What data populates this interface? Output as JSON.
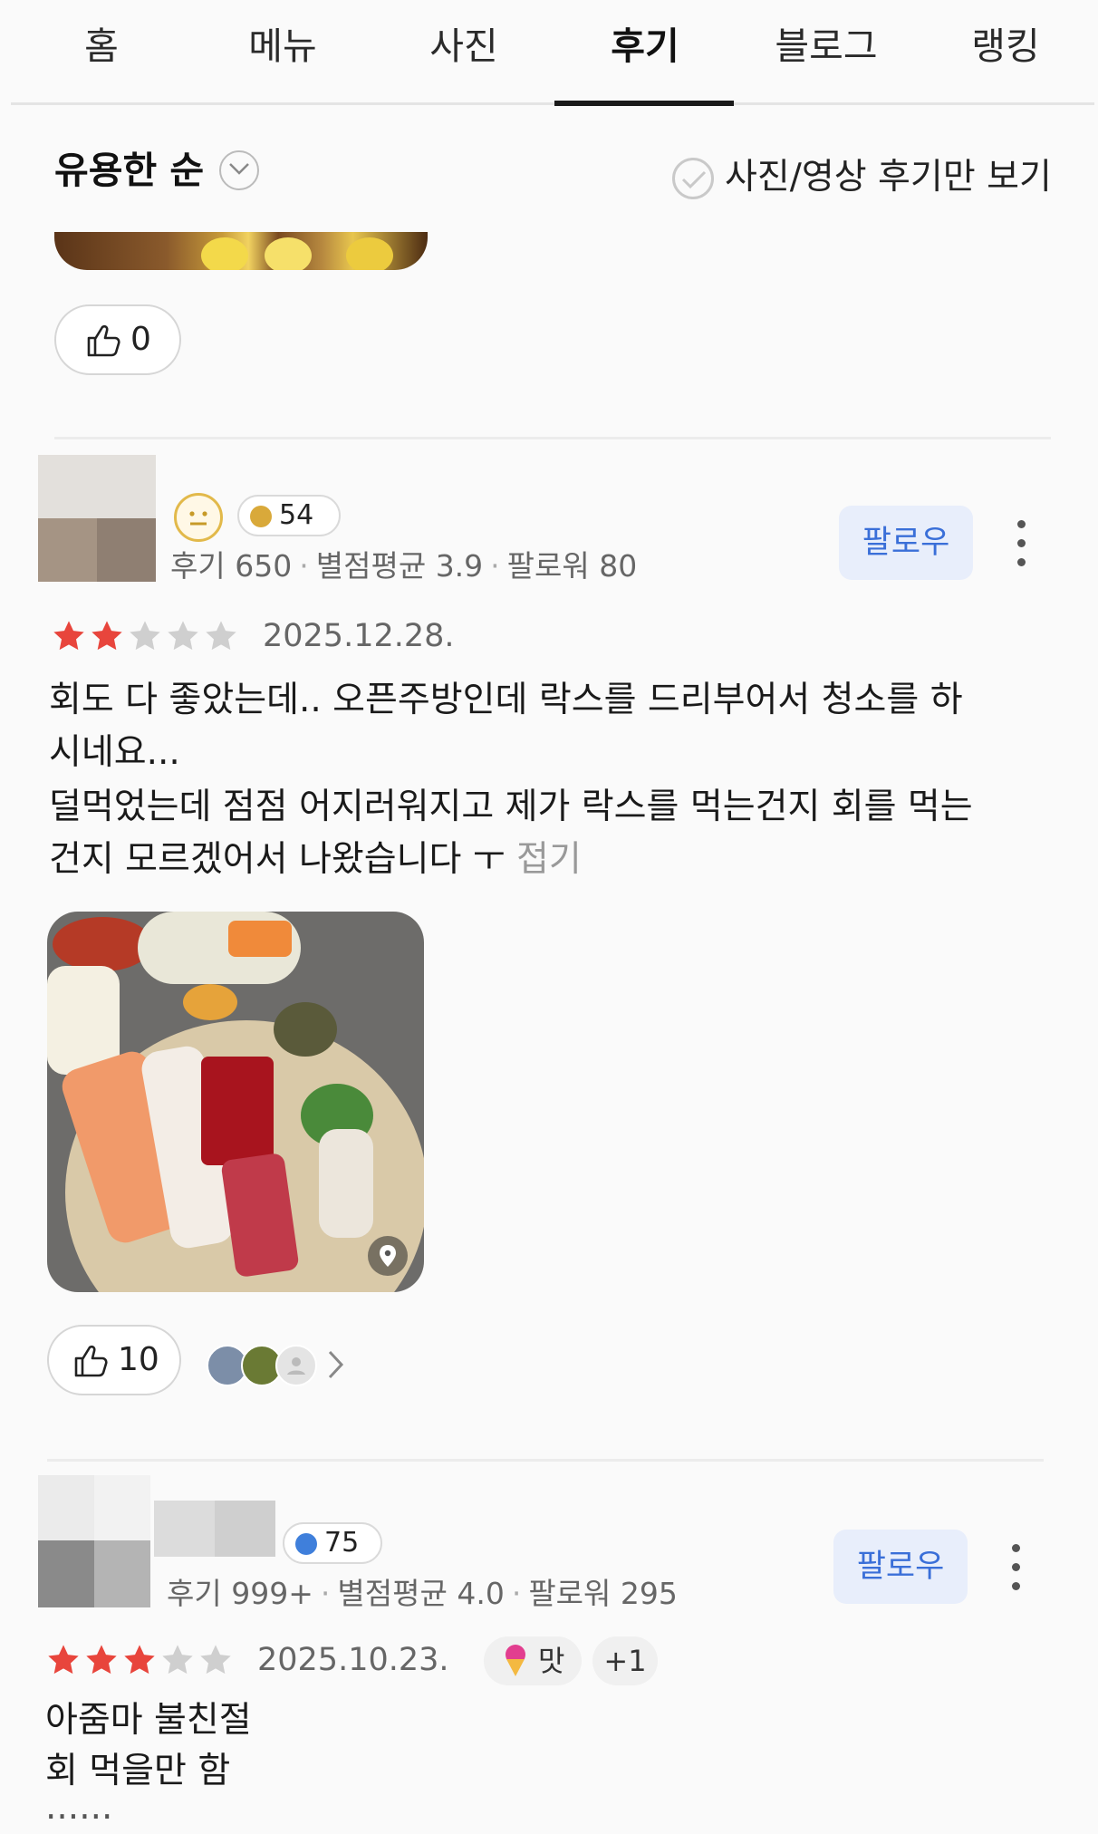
{
  "tabs": [
    {
      "label": "홈",
      "active": false
    },
    {
      "label": "메뉴",
      "active": false
    },
    {
      "label": "사진",
      "active": false
    },
    {
      "label": "후기",
      "active": true
    },
    {
      "label": "블로그",
      "active": false
    },
    {
      "label": "랭킹",
      "active": false
    }
  ],
  "sort": {
    "label": "유용한 순",
    "icon": "chevron-down-icon"
  },
  "filter": {
    "label": "사진/영상 후기만 보기",
    "checked": false,
    "icon": "check-icon"
  },
  "prev_review": {
    "likes": "0"
  },
  "reviews": [
    {
      "badge_level": "54",
      "badge_color": "#d9a93a",
      "stats": {
        "reviews_label": "후기",
        "reviews": "650",
        "rating_label": "별점평균",
        "rating": "3.9",
        "followers_label": "팔로워",
        "followers": "80"
      },
      "follow_label": "팔로우",
      "rating_stars": 2,
      "date": "2025.12.28.",
      "text_lines": [
        "회도 다 좋았는데.. 오픈주방인데 락스를 드리부어서 청소를 하",
        "시네요...",
        "덜먹었는데 점점 어지러워지고 제가 락스를 먹는건지 회를 먹는",
        "건지 모르겠어서 나왔습니다 ㅜ"
      ],
      "fold_label": "접기",
      "likes": "10"
    },
    {
      "badge_level": "75",
      "badge_color": "#3f7fdb",
      "stats": {
        "reviews_label": "후기",
        "reviews": "999+",
        "rating_label": "별점평균",
        "rating": "4.0",
        "followers_label": "팔로워",
        "followers": "295"
      },
      "follow_label": "팔로우",
      "rating_stars": 3,
      "date": "2025.10.23.",
      "tag": "맛",
      "tag_more": "+1",
      "text_lines": [
        "아줌마 불친절",
        "회 먹을만 함",
        "......"
      ]
    }
  ],
  "colors": {
    "star_filled": "#e8453c",
    "star_empty": "#cfcfcf",
    "follow_text": "#3a6fd8",
    "follow_bg": "#e8eefb"
  }
}
